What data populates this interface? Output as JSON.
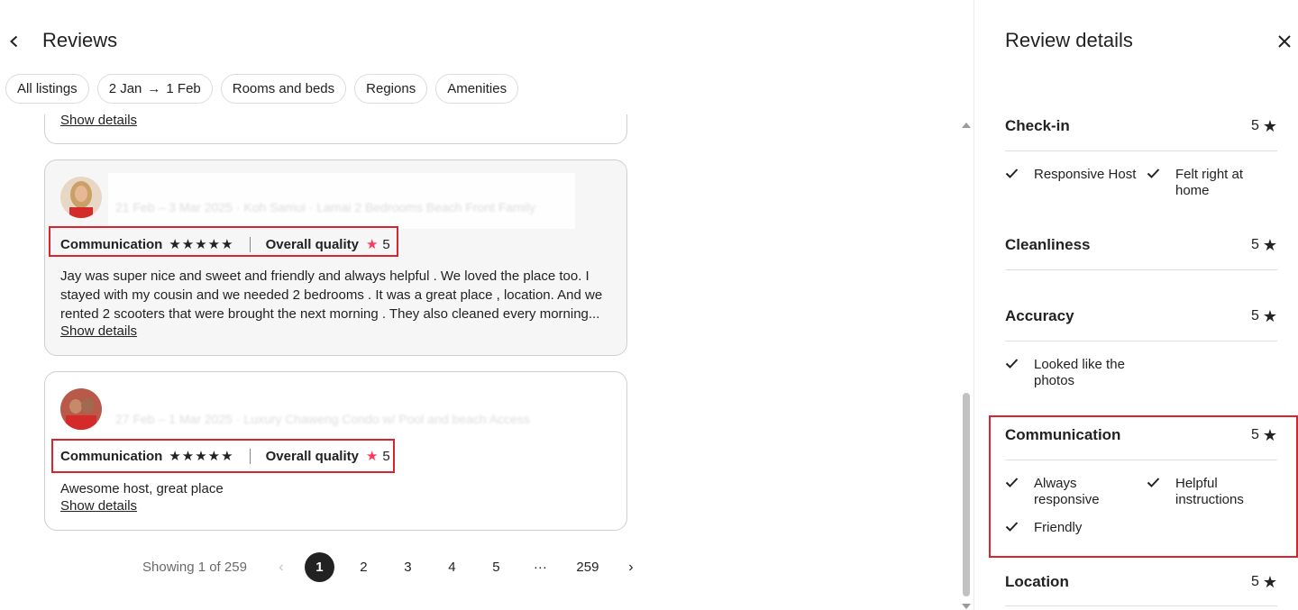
{
  "header": {
    "title": "Reviews"
  },
  "filters": {
    "all_listings": "All listings",
    "date_from": "2 Jan",
    "date_arrow": "→",
    "date_to": "1 Feb",
    "rooms": "Rooms and beds",
    "regions": "Regions",
    "amenities": "Amenities"
  },
  "reviews": {
    "show_details": "Show details",
    "cards": [
      {
        "guest_name": "",
        "stay_line": "21 Feb – 3 Mar 2025 · Koh Samui · Lamai 2 Bedrooms Beach Front Family",
        "rating_label": "Communication",
        "stars": "★★★★★",
        "overall_label": "Overall quality",
        "overall_score": "5",
        "text": "Jay was super nice and sweet and friendly and always helpful . We loved the place too. I stayed with my cousin and we needed 2 bedrooms . It was a great place , location. And we rented 2 scooters that were brought the next morning . They also cleaned every morning..."
      },
      {
        "guest_name": "",
        "stay_line": "27 Feb – 1 Mar 2025 · Luxury Chaweng Condo w/ Pool and beach Access",
        "rating_label": "Communication",
        "stars": "★★★★★",
        "overall_label": "Overall quality",
        "overall_score": "5",
        "text": "Awesome host, great place"
      }
    ]
  },
  "pagination": {
    "showing": "Showing 1 of 259",
    "pages": [
      "1",
      "2",
      "3",
      "4",
      "5"
    ],
    "ellipsis": "···",
    "last": "259",
    "current": "1"
  },
  "panel": {
    "title": "Review details",
    "star": "★",
    "categories": {
      "checkin": {
        "name": "Check-in",
        "score": "5",
        "tags": [
          "Responsive Host",
          "Felt right at home"
        ]
      },
      "cleanliness": {
        "name": "Cleanliness",
        "score": "5"
      },
      "accuracy": {
        "name": "Accuracy",
        "score": "5",
        "tags": [
          "Looked like the photos"
        ]
      },
      "communication": {
        "name": "Communication",
        "score": "5",
        "tags": [
          "Always responsive",
          "Helpful instructions",
          "Friendly"
        ]
      },
      "location": {
        "name": "Location",
        "score": "5"
      }
    }
  },
  "colors": {
    "highlight": "#d9232e",
    "accent_star": "#ff385c",
    "text": "#222222"
  },
  "icons": {
    "back": "chevron-left-icon",
    "close": "close-icon",
    "check": "check-icon",
    "star": "star-icon"
  }
}
